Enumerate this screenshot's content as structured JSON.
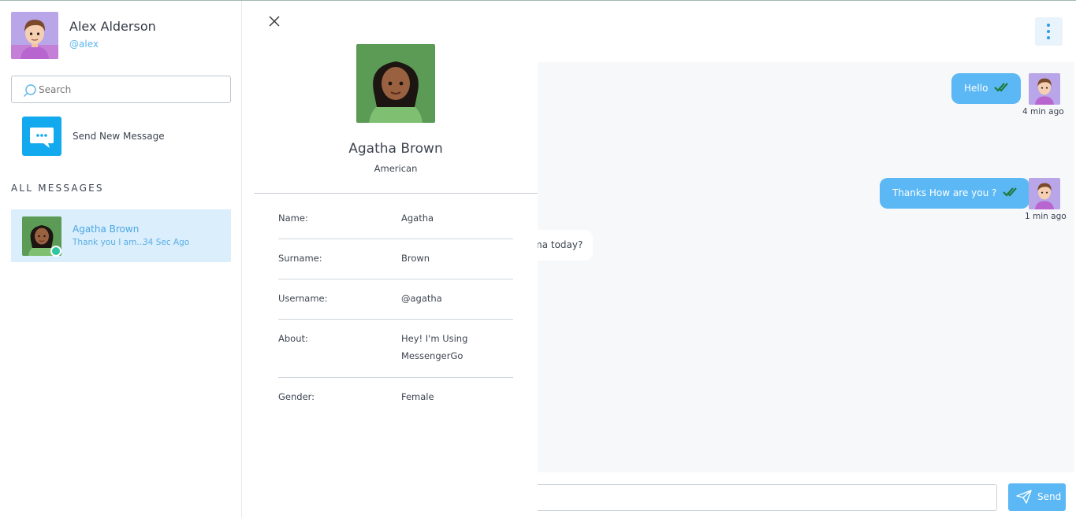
{
  "user": {
    "name": "Alex Alderson",
    "handle": "@alex"
  },
  "search": {
    "placeholder": "Search"
  },
  "sidebar": {
    "new_message_label": "Send New Message",
    "section_label": "ALL MESSAGES",
    "conversations": [
      {
        "name": "Agatha Brown",
        "preview": "Thank you I am...",
        "time": "34 Sec Ago",
        "online": true
      }
    ]
  },
  "chat": {
    "messages": [
      {
        "direction": "out",
        "text": "Hello",
        "status_icon": "double-check-icon",
        "time": "4 min ago"
      },
      {
        "direction": "out",
        "text": "Thanks How are you ?",
        "status_icon": "double-check-icon",
        "time": "1 min ago"
      },
      {
        "direction": "in",
        "text": "ma today?"
      }
    ],
    "composer": {
      "placeholder": "",
      "send_label": "Send"
    }
  },
  "profile": {
    "name": "Agatha Brown",
    "subtitle": "American",
    "fields": [
      {
        "label": "Name:",
        "value": "Agatha"
      },
      {
        "label": "Surname:",
        "value": "Brown"
      },
      {
        "label": "Username:",
        "value": "@agatha"
      },
      {
        "label": "About:",
        "value": "Hey! I'm Using MessengerGo"
      },
      {
        "label": "Gender:",
        "value": "Female"
      }
    ]
  },
  "colors": {
    "accent": "#5bb8f5",
    "accent_dark": "#13a9ee",
    "online": "#2cc7a0",
    "selected_bg": "#daeefc",
    "chat_bg": "#f6f8fa"
  }
}
